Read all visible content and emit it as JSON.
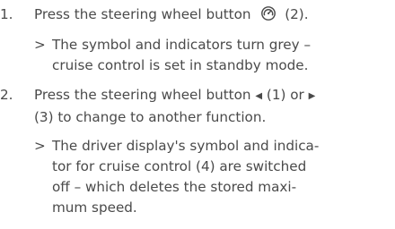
{
  "steps": [
    {
      "number": "1.",
      "text_before_icon": "Press the steering wheel button",
      "icon": "steering-wheel-cruise-icon",
      "text_after_icon": "(2).",
      "result": {
        "marker": ">",
        "lines": [
          "The symbol and indicators turn grey –",
          "cruise control is set in standby mode."
        ]
      }
    },
    {
      "number": "2.",
      "line1_before": "Press the steering wheel button",
      "left_icon": "◀",
      "line1_mid": "(1) or",
      "right_icon": "▶",
      "line2": "(3) to change to another function.",
      "result": {
        "marker": ">",
        "lines": [
          "The driver display's symbol and indica-",
          "tor for cruise control (4) are switched",
          "off – which deletes the stored maxi-",
          "mum speed."
        ]
      }
    }
  ]
}
